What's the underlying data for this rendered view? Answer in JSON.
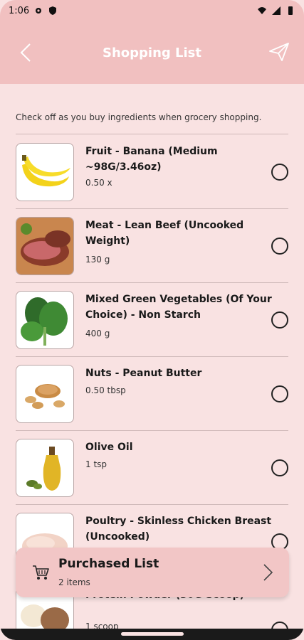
{
  "status_bar": {
    "time": "1:06"
  },
  "header": {
    "title": "Shopping List"
  },
  "instructions": "Check off as you buy ingredients when grocery shopping.",
  "items": [
    {
      "name": "Fruit - Banana (Medium ~98G/3.46oz)",
      "quantity": "0.50 x",
      "checked": false,
      "image_icon": "banana-image"
    },
    {
      "name": "Meat - Lean Beef (Uncooked Weight)",
      "quantity": "130 g",
      "checked": false,
      "image_icon": "beef-image"
    },
    {
      "name": "Mixed Green Vegetables (Of Your Choice) - Non Starch",
      "quantity": "400 g",
      "checked": false,
      "image_icon": "vegetables-image"
    },
    {
      "name": "Nuts - Peanut Butter",
      "quantity": "0.50 tbsp",
      "checked": false,
      "image_icon": "peanut-butter-image"
    },
    {
      "name": "Olive Oil",
      "quantity": "1 tsp",
      "checked": false,
      "image_icon": "olive-oil-image"
    },
    {
      "name": "Poultry - Skinless Chicken Breast (Uncooked)",
      "quantity": "",
      "checked": false,
      "image_icon": "chicken-image"
    },
    {
      "name": "Protein Powder (30G Scoop)",
      "quantity": "1 scoop",
      "checked": false,
      "image_icon": "protein-powder-image"
    }
  ],
  "purchased_list": {
    "title": "Purchased List",
    "count": "2 items"
  },
  "colors": {
    "header_bg": "#f1c0c0",
    "page_bg": "#f9e2e2",
    "card_bg": "#f2c6c6"
  }
}
